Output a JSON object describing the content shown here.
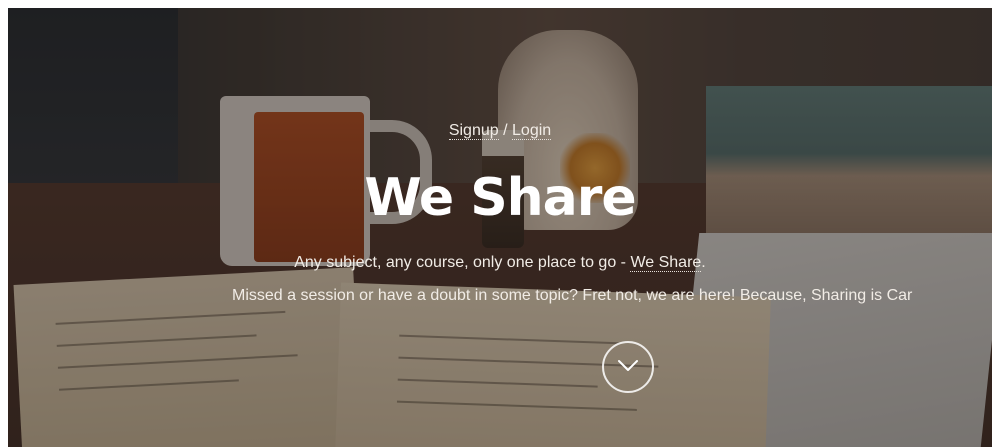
{
  "auth": {
    "signup_label": "Signup",
    "separator": "/",
    "login_label": "Login"
  },
  "hero": {
    "title": "We Share",
    "tagline_prefix": "Any subject, any course, only one place to go - ",
    "tagline_link": "We Share",
    "tagline_suffix": ".",
    "subtitle": "Missed a session or have a doubt in some topic? Fret not, we are here! Because, Sharing is Car"
  },
  "icons": {
    "scroll_down": "chevron-down-circle-icon"
  },
  "colors": {
    "text": "#f1ece6",
    "title": "#ffffff"
  }
}
